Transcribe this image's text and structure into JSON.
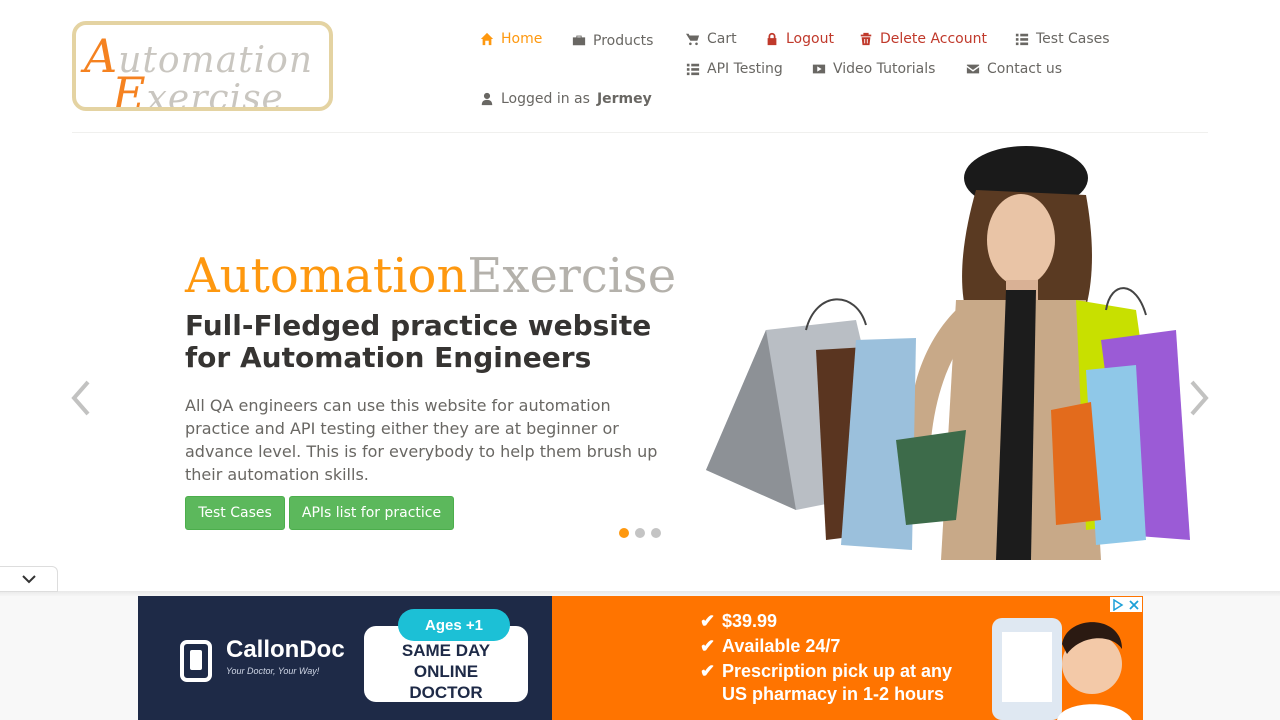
{
  "logo": {
    "line1_big": "A",
    "line1_rest": "utomation",
    "line2_big": "E",
    "line2_rest": "xercise"
  },
  "nav": {
    "home": "Home",
    "products": "Products",
    "cart": "Cart",
    "logout": "Logout",
    "delete_account": "Delete Account",
    "test_cases": "Test Cases",
    "api_testing": "API Testing",
    "video_tutorials": "Video Tutorials",
    "contact_us": "Contact us",
    "logged_in_prefix": "Logged in as",
    "username": "Jermey"
  },
  "slider": {
    "brand_a": "Automation",
    "brand_b": "Exercise",
    "headline": "Full-Fledged practice website for Automation Engineers",
    "description": "All QA engineers can use this website for automation practice and API testing either they are at beginner or advance level. This is for everybody to help them brush up their automation skills.",
    "btn_test_cases": "Test Cases",
    "btn_apis": "APIs list for practice",
    "active_slide": 1,
    "slide_count": 3
  },
  "ad": {
    "brand": "CallonDoc",
    "tagline": "Your Doctor, Your Way!",
    "pill": "Ages +1",
    "card_lines": [
      "SAME DAY",
      "ONLINE",
      "DOCTOR"
    ],
    "bullets": [
      "$39.99",
      "Available 24/7",
      "Prescription pick up at any",
      "US pharmacy in 1-2 hours"
    ]
  },
  "colors": {
    "accent": "#fe980f",
    "danger": "#c0392b",
    "button": "#5cb85c",
    "ad_navy": "#1e2a47",
    "ad_orange": "#ff7400"
  }
}
